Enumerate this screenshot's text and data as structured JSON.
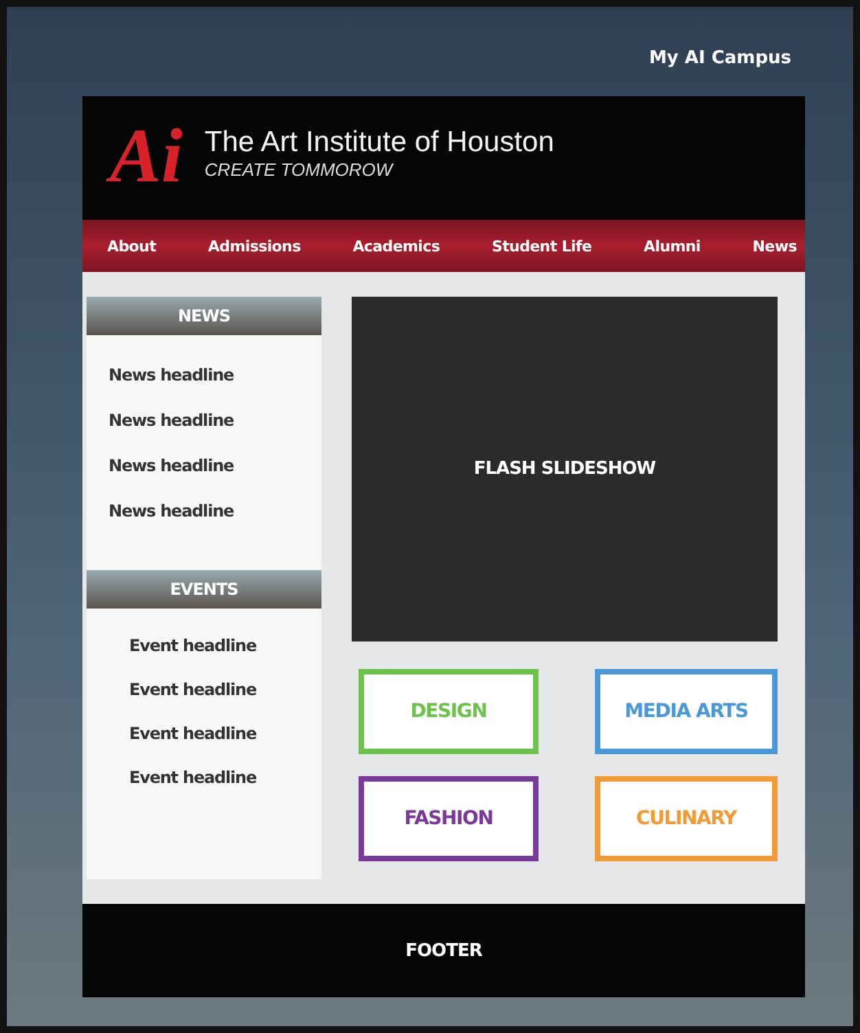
{
  "top_link": "My AI Campus",
  "header": {
    "logo": "Ai",
    "title": "The Art Institute of Houston",
    "tagline": "CREATE TOMMOROW"
  },
  "nav": [
    "About",
    "Admissions",
    "Academics",
    "Student Life",
    "Alumni",
    "News"
  ],
  "news": {
    "title": "NEWS",
    "items": [
      "News headline",
      "News headline",
      "News headline",
      "News headline"
    ]
  },
  "events": {
    "title": "EVENTS",
    "items": [
      "Event headline",
      "Event headline",
      "Event headline",
      "Event headline"
    ]
  },
  "slideshow": "FLASH SLIDESHOW",
  "programs": [
    {
      "label": "DESIGN",
      "color": "#6cc24a"
    },
    {
      "label": "MEDIA ARTS",
      "color": "#4a98d8"
    },
    {
      "label": "FASHION",
      "color": "#7b3a9a"
    },
    {
      "label": "CULINARY",
      "color": "#f29a34"
    }
  ],
  "footer": "FOOTER"
}
